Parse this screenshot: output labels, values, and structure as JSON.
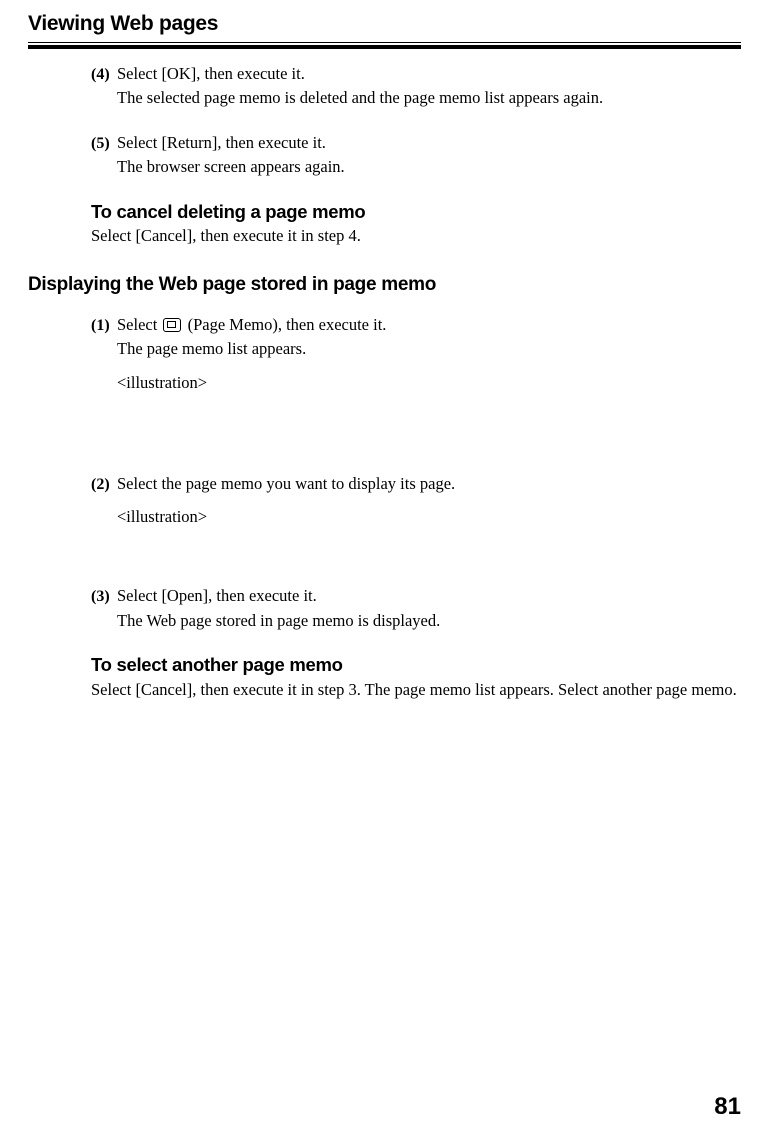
{
  "pageTitle": "Viewing Web pages",
  "steps_a": {
    "s4": {
      "num": "(4)",
      "line1": "Select [OK], then execute it.",
      "line2": "The selected page memo is deleted and the page memo list appears again."
    },
    "s5": {
      "num": "(5)",
      "line1": "Select [Return], then execute it.",
      "line2": "The browser screen appears again."
    }
  },
  "cancelDelete": {
    "heading": "To cancel deleting a page memo",
    "text": "Select [Cancel], then execute it in step 4."
  },
  "sectionHeading": "Displaying the Web page stored in page memo",
  "steps_b": {
    "s1": {
      "num": "(1)",
      "prefix": "Select ",
      "iconLabel": "(Page Memo), then execute it.",
      "line2": "The page memo list appears.",
      "illus": "<illustration>"
    },
    "s2": {
      "num": "(2)",
      "line1": "Select the page memo you want to display its page.",
      "illus": "<illustration>"
    },
    "s3": {
      "num": "(3)",
      "line1": "Select [Open], then execute it.",
      "line2": "The Web page stored in page memo is displayed."
    }
  },
  "selectAnother": {
    "heading": "To select another page memo",
    "text": "Select [Cancel], then execute it in step 3. The page memo list appears. Select another page memo."
  },
  "pageNumber": "81"
}
